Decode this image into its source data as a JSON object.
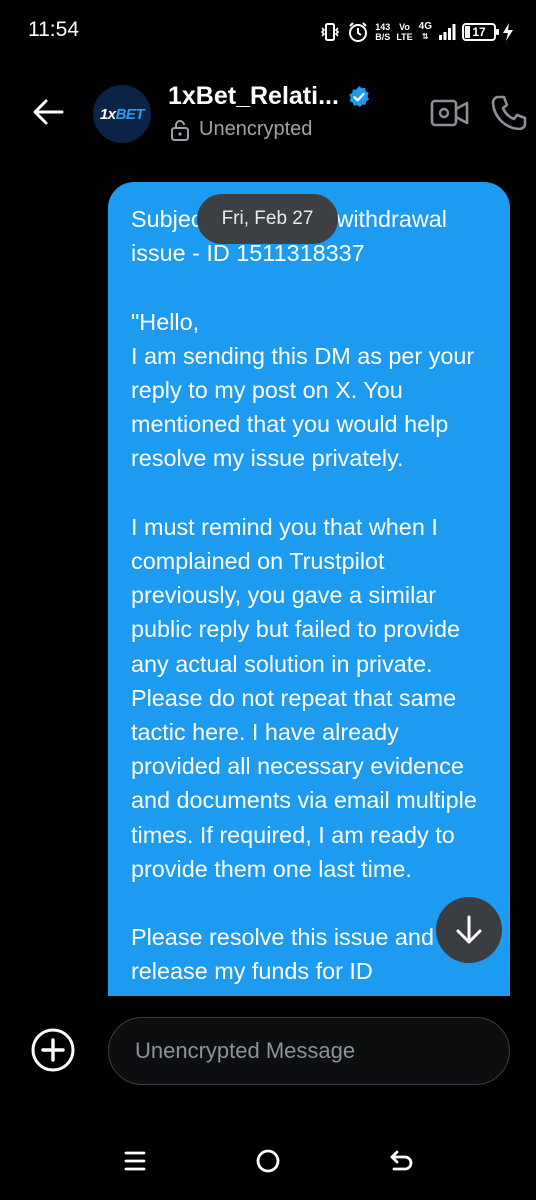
{
  "status_bar": {
    "time": "11:54",
    "net_speed_value": "143",
    "net_speed_unit": "B/S",
    "volte_top": "Vo",
    "volte_bottom": "LTE",
    "network_type": "4G",
    "battery_level": "17",
    "battery_fraction": 0.17
  },
  "header": {
    "contact_name": "1xBet_Relati...",
    "avatar_text_1x": "1x",
    "avatar_text_bet": "BET",
    "encryption_label": "Unencrypted",
    "icons": {
      "back": "arrow-left-icon",
      "verified": "verified-badge-icon",
      "lock": "lock-open-icon",
      "video": "video-call-icon",
      "call": "phone-icon"
    }
  },
  "conversation": {
    "date_label": "Fri, Feb 27",
    "message_text": "Subject: Regarding withdrawal issue - ID 1511318337\n\n\"Hello,\nI am sending this DM as per your reply to my post on X. You mentioned that you would help resolve my issue privately.\n\nI must remind you that when I complained on Trustpilot previously, you gave a similar public reply but failed to provide any actual solution in private. Please do not repeat that same tactic here. I have already provided all necessary evidence and documents via email multiple times. If required, I am ready to provide them one last time.\n\nPlease resolve this issue and release my funds for ID",
    "bubble_color": "#1d9bf0"
  },
  "composer": {
    "placeholder": "Unencrypted Message",
    "value": ""
  },
  "colors": {
    "background": "#000000",
    "accent": "#1d9bf0",
    "muted_text": "#9aa3ab"
  }
}
